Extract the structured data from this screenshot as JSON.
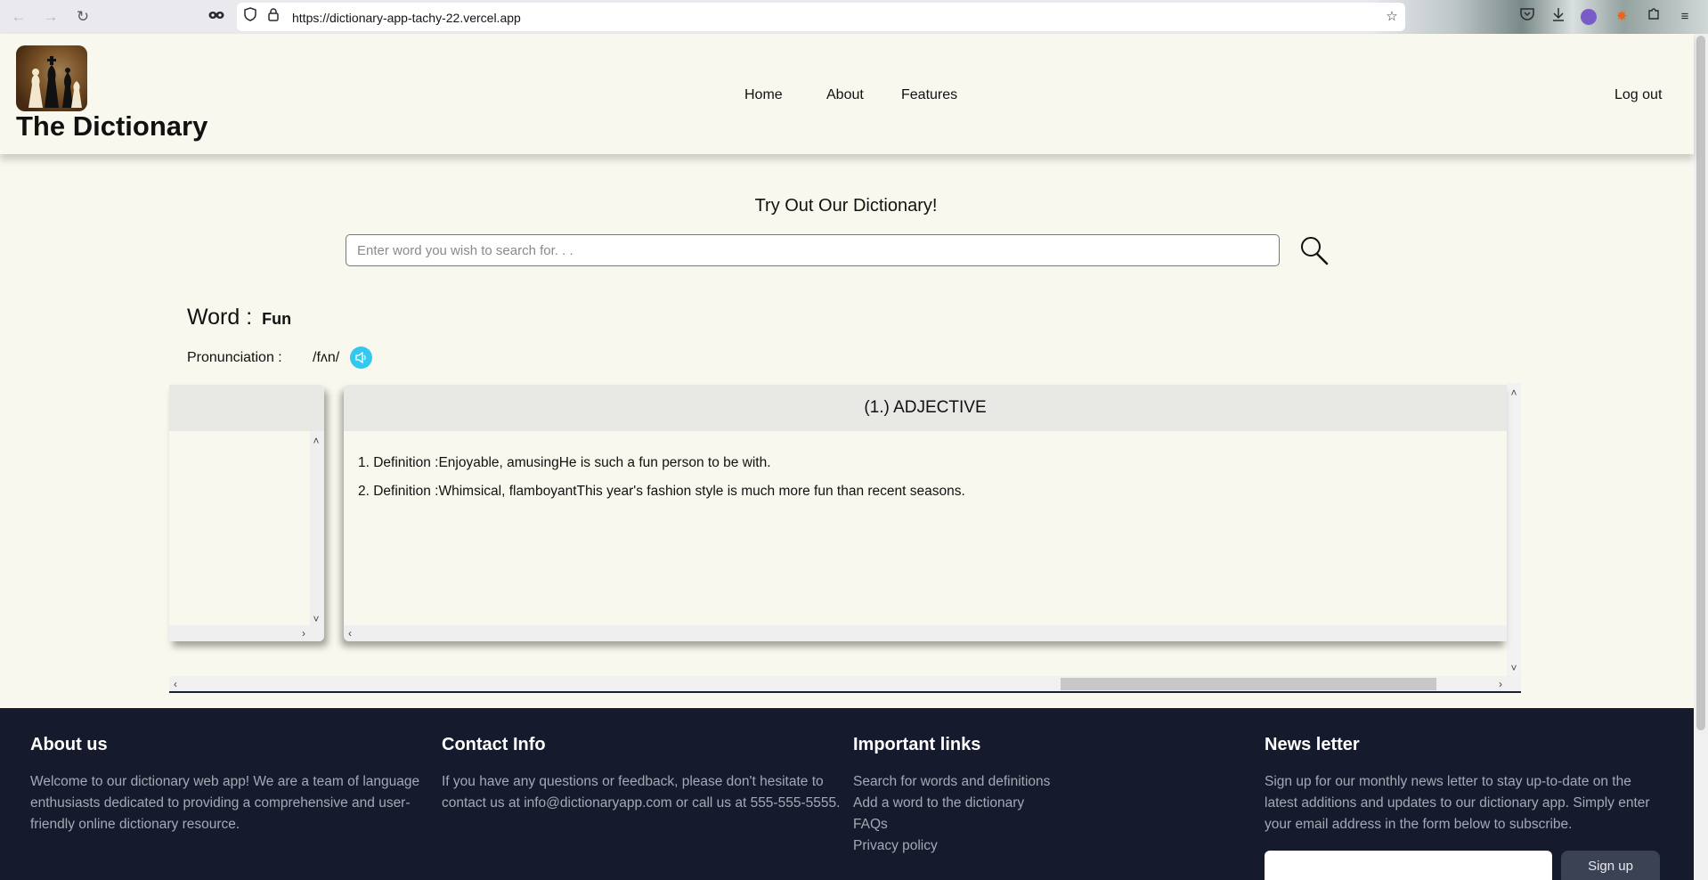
{
  "browser": {
    "url": "https://dictionary-app-tachy-22.vercel.app",
    "icons": [
      "back-icon",
      "forward-icon",
      "reload-icon",
      "tracking-mask-icon",
      "shield-icon",
      "lock-icon",
      "star-icon",
      "pocket-icon",
      "download-icon",
      "profile-icon",
      "extension-icon",
      "puzzle-icon",
      "menu-icon"
    ]
  },
  "header": {
    "title": "The Dictionary",
    "nav": [
      "Home",
      "About",
      "Features"
    ],
    "logout": "Log out"
  },
  "search": {
    "heading": "Try Out Our Dictionary!",
    "placeholder": "Enter word you wish to search for. . ."
  },
  "result": {
    "word_label": "Word :",
    "word": "Fun",
    "pronunciation_label": "Pronunciation :",
    "pronunciation": "/fʌn/",
    "cards": [
      {
        "heading": "(1.) ADJECTIVE",
        "definitions": [
          "1. Definition :Enjoyable, amusingHe is such a fun person to be with.",
          "2. Definition :Whimsical, flamboyantThis year's fashion style is much more fun than recent seasons."
        ]
      }
    ]
  },
  "footer": {
    "about": {
      "title": "About us",
      "text": "Welcome to our dictionary web app! We are a team of language enthusiasts dedicated to providing a comprehensive and user-friendly online dictionary resource."
    },
    "contact": {
      "title": "Contact Info",
      "text": "If you have any questions or feedback, please don't hesitate to contact us at info@dictionaryapp.com or call us at 555-555-5555."
    },
    "links": {
      "title": "Important links",
      "items": [
        "Search for words and definitions",
        "Add a word to the dictionary",
        "FAQs",
        "Privacy policy"
      ]
    },
    "newsletter": {
      "title": "News letter",
      "text": "Sign up for our monthly news letter to stay up-to-date on the latest additions and updates to our dictionary app. Simply enter your email address in the form below to subscribe.",
      "button": "Sign up"
    }
  },
  "colors": {
    "page_bg": "#f8f8ee",
    "footer_bg": "#151a2d",
    "speaker": "#33c9ee"
  }
}
